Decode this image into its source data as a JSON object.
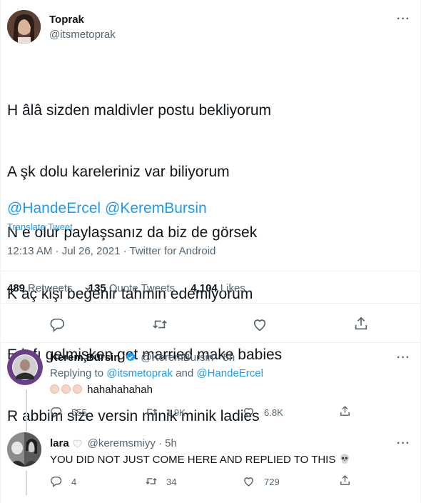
{
  "tweet": {
    "author_name": "Toprak",
    "author_handle": "@itsmetoprak",
    "lines": [
      "H âlâ sizden maldivler postu bekliyorum",
      "A şk dolu kareleriniz var biliyorum",
      "N e olur paylaşsanız da biz de görsek",
      "K aç kişi beğenir tahmin edemiyorum",
      "E lafı gelmişken get married make babies",
      "R abbim size versin minik minik ladies"
    ],
    "mentions": [
      "@HandeErcel",
      "@KeremBursin"
    ],
    "translate_label": "Translate Tweet",
    "timestamp": "12:13 AM · Jul 26, 2021 · Twitter for Android",
    "stats": {
      "retweets_count": "489",
      "retweets_label": "Retweets",
      "quotes_count": "135",
      "quotes_label": "Quote Tweets",
      "likes_count": "4,104",
      "likes_label": "Likes"
    }
  },
  "replies": [
    {
      "name": "Kerem Bürsin",
      "verified": true,
      "handle": "@KeremBursin · 5h",
      "replying_prefix": "Replying to",
      "replying_user1": "@itsmetoprak",
      "replying_and": "and",
      "replying_user2": "@HandeErcel",
      "text": "hahahahahah",
      "emoji_count": 3,
      "reply_count": "555",
      "retweet_count": "1.9K",
      "like_count": "6.8K"
    },
    {
      "name": "lara",
      "handle": "@keremsmiyy · 5h",
      "text": "YOU DID NOT JUST COME HERE AND REPLIED TO THIS",
      "reply_count": "4",
      "retweet_count": "34",
      "like_count": "729"
    }
  ],
  "colors": {
    "accent": "#1d9bf0",
    "secondary_text": "#536471",
    "divider": "#eff3f4",
    "verified": "#1d9bf0"
  },
  "icons": [
    "more-icon",
    "reply-icon",
    "retweet-icon",
    "like-icon",
    "share-icon",
    "verified-badge-icon",
    "heart-emoji-icon",
    "skull-emoji-icon",
    "clap-emoji-icon"
  ]
}
